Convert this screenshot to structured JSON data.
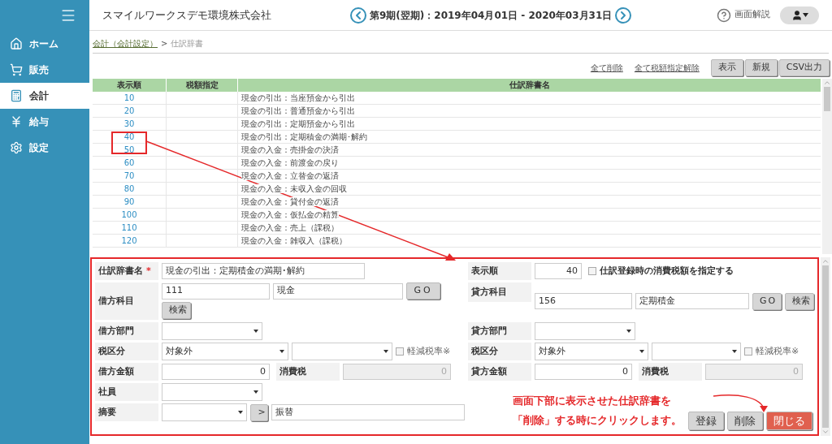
{
  "header": {
    "company": "スマイルワークスデモ環境株式会社",
    "period": "第9期(翌期)：2019年04月01日 - 2020年03月31日",
    "help_label": "画面解説"
  },
  "sidebar": {
    "items": [
      {
        "label": "ホーム",
        "selected": false
      },
      {
        "label": "販売",
        "selected": false
      },
      {
        "label": "会計",
        "selected": true
      },
      {
        "label": "給与",
        "selected": false
      },
      {
        "label": "設定",
        "selected": false
      }
    ]
  },
  "breadcrumb": {
    "link": "会計（会計設定）",
    "separator": ">",
    "current": "仕訳辞書"
  },
  "toolbar": {
    "links": [
      "全て削除",
      "全て税額指定解除"
    ],
    "buttons": [
      "表示",
      "新規",
      "CSV出力"
    ]
  },
  "table": {
    "columns": [
      "表示順",
      "税額指定",
      "仕訳辞書名"
    ],
    "rows": [
      {
        "order": "10",
        "name": "現金の引出：当座預金から引出"
      },
      {
        "order": "20",
        "name": "現金の引出：普通預金から引出"
      },
      {
        "order": "30",
        "name": "現金の引出：定期預金から引出"
      },
      {
        "order": "40",
        "name": "現金の引出：定期積金の満期･解約"
      },
      {
        "order": "50",
        "name": "現金の入金：売掛金の決済"
      },
      {
        "order": "60",
        "name": "現金の入金：前渡金の戻り"
      },
      {
        "order": "70",
        "name": "現金の入金：立替金の返済"
      },
      {
        "order": "80",
        "name": "現金の入金：未収入金の回収"
      },
      {
        "order": "90",
        "name": "現金の入金：貸付金の返済"
      },
      {
        "order": "100",
        "name": "現金の入金：仮払金の精算"
      },
      {
        "order": "110",
        "name": "現金の入金：売上（課税）"
      },
      {
        "order": "120",
        "name": "現金の入金：雑収入（課税）"
      }
    ]
  },
  "form": {
    "name": {
      "label": "仕訳辞書名",
      "required_mark": "*",
      "value": "現金の引出：定期積金の満期･解約"
    },
    "order": {
      "label": "表示順",
      "value": "40"
    },
    "tax_amount_option": {
      "label": "仕訳登録時の消費税額を指定する",
      "checked": false
    },
    "debit_account": {
      "label": "借方科目",
      "code": "111",
      "account": "現金",
      "go": "GO",
      "search": "検索"
    },
    "credit_account": {
      "label": "貸方科目",
      "code": "156",
      "account": "定期積金",
      "go": "GO",
      "search": "検索"
    },
    "debit_dept": {
      "label": "借方部門"
    },
    "credit_dept": {
      "label": "貸方部門"
    },
    "debit_tax": {
      "label": "税区分",
      "value": "対象外",
      "reduced_label": "軽減税率※",
      "reduced_checked": false
    },
    "credit_tax": {
      "label": "税区分",
      "value": "対象外",
      "reduced_label": "軽減税率※",
      "reduced_checked": false
    },
    "debit_amount": {
      "label": "借方金額",
      "value": "0",
      "tax_label": "消費税",
      "tax_value": "0"
    },
    "credit_amount": {
      "label": "貸方金額",
      "value": "0",
      "tax_label": "消費税",
      "tax_value": "0"
    },
    "staff": {
      "label": "社員"
    },
    "summary": {
      "label": "摘要",
      "button": ">",
      "value": "振替"
    },
    "actions": [
      {
        "label": "登録",
        "kind": "default"
      },
      {
        "label": "削除",
        "kind": "default"
      },
      {
        "label": "閉じる",
        "kind": "danger"
      }
    ]
  },
  "annotation": {
    "lines": [
      "画面下部に表示させた仕訳辞書を",
      "「削除」する時にクリックします。"
    ]
  }
}
